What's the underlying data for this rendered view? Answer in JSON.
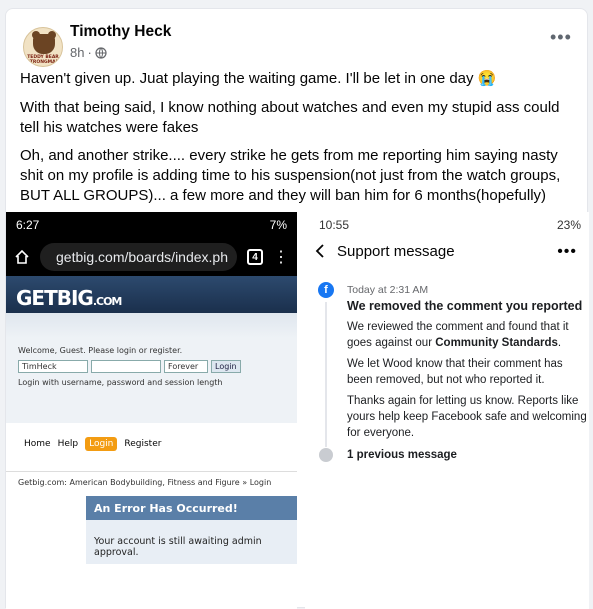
{
  "post": {
    "author": "Timothy Heck",
    "time": "8h",
    "visibility_icon": "globe-icon",
    "avatar_text": "TEDDY BEAR STRONGMAN",
    "paragraphs": [
      "Haven't given up. Juat playing the waiting game. I'll be let in one day 😭",
      "With that being said, I know nothing about watches and even my stupid ass could tell his watches were fakes",
      "Oh, and another strike.... every strike he gets from me reporting him saying nasty shit on my profile is adding time to his suspension(not just from the watch groups, BUT ALL GROUPS)... a few more and they will ban him for 6 months(hopefully)"
    ]
  },
  "left_screenshot": {
    "status_time": "6:27",
    "status_battery": "7%",
    "url": "getbig.com/boards/index.ph",
    "tab_count": "4",
    "logo": "GETBIG",
    "logo_suffix": ".COM",
    "welcome": "Welcome, Guest. Please login or register.",
    "username_value": "TimHeck",
    "duration": "Forever",
    "login_button": "Login",
    "hint": "Login with username, password and session length",
    "nav": [
      "Home",
      "Help",
      "Login",
      "Register"
    ],
    "breadcrumb": "Getbig.com: American Bodybuilding, Fitness and Figure » Login",
    "error_title": "An Error Has Occurred!",
    "error_message": "Your account is still awaiting admin approval."
  },
  "right_screenshot": {
    "status_time": "10:55",
    "status_battery": "23%",
    "title": "Support message",
    "timestamp": "Today at 2:31 AM",
    "heading": "We removed the comment you reported",
    "para1_prefix": "We reviewed the comment and found that it goes against our ",
    "para1_link": "Community Standards",
    "para1_suffix": ".",
    "para2": "We let Wood know that their comment has been removed, but not who reported it.",
    "para3": "Thanks again for letting us know. Reports like yours help keep Facebook safe and welcoming for everyone.",
    "previous": "1 previous message"
  }
}
